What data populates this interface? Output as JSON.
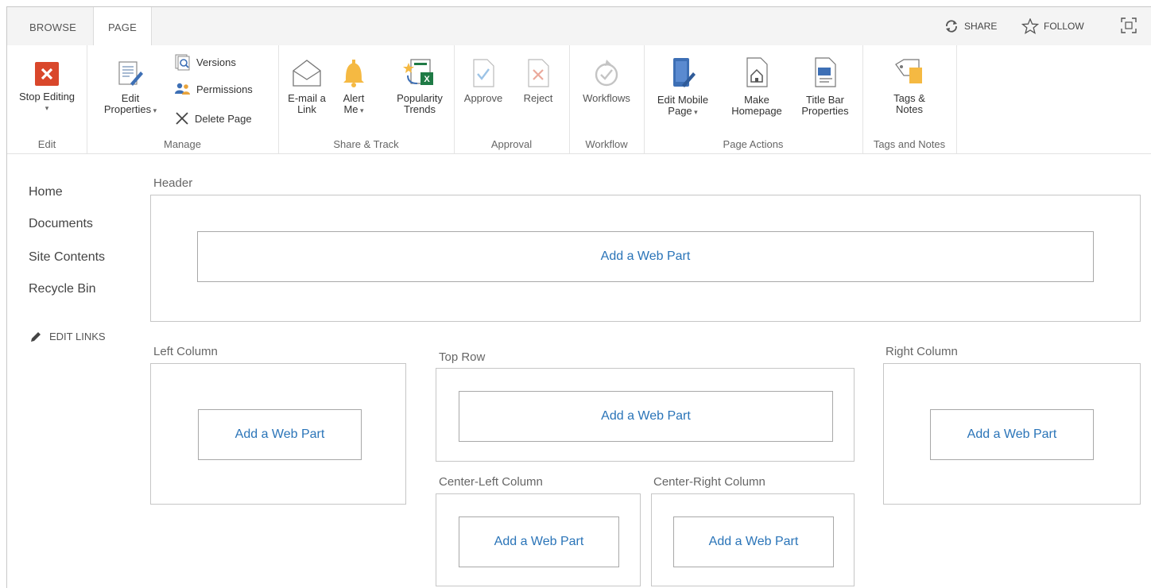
{
  "tabs": {
    "browse": "BROWSE",
    "page": "PAGE"
  },
  "top_actions": {
    "share": "SHARE",
    "follow": "FOLLOW"
  },
  "ribbon": {
    "edit": {
      "stop_editing": "Stop Editing",
      "label": "Edit"
    },
    "manage": {
      "edit_properties_1": "Edit",
      "edit_properties_2": "Properties",
      "versions": "Versions",
      "permissions": "Permissions",
      "delete_page": "Delete Page",
      "label": "Manage"
    },
    "share_track": {
      "email_1": "E-mail a",
      "email_2": "Link",
      "alert_1": "Alert",
      "alert_2": "Me",
      "popularity_1": "Popularity",
      "popularity_2": "Trends",
      "label": "Share & Track"
    },
    "approval": {
      "approve": "Approve",
      "reject": "Reject",
      "label": "Approval"
    },
    "workflow": {
      "workflows": "Workflows",
      "label": "Workflow"
    },
    "page_actions": {
      "mobile_1": "Edit Mobile",
      "mobile_2": "Page",
      "home_1": "Make",
      "home_2": "Homepage",
      "title_1": "Title Bar",
      "title_2": "Properties",
      "label": "Page Actions"
    },
    "tags": {
      "tags_1": "Tags &",
      "tags_2": "Notes",
      "label": "Tags and Notes"
    }
  },
  "nav": {
    "items": [
      "Home",
      "Documents",
      "Site Contents",
      "Recycle Bin"
    ],
    "edit_links": "EDIT LINKS"
  },
  "zones": {
    "header": "Header",
    "left_column": "Left Column",
    "top_row": "Top Row",
    "right_column": "Right Column",
    "center_left_column": "Center-Left Column",
    "center_right_column": "Center-Right Column",
    "add_web_part": "Add a Web Part"
  },
  "colors": {
    "accent_blue": "#2a74b8",
    "stop_red": "#d9472b",
    "alert_orange": "#f5b942",
    "excel_green": "#1f7a45"
  }
}
